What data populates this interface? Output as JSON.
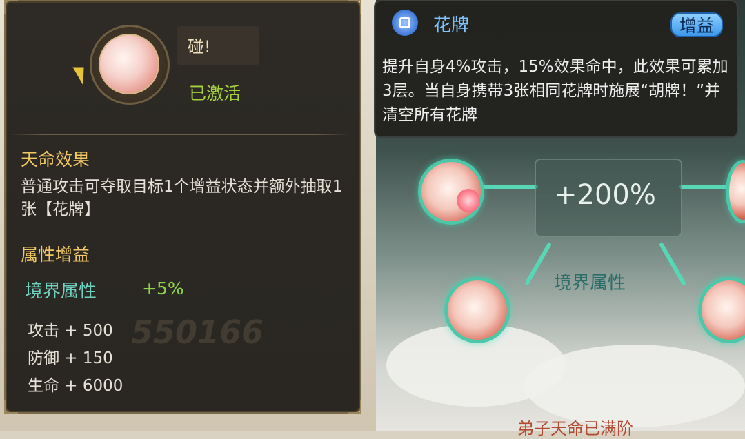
{
  "left_panel": {
    "skill_title": "碰!",
    "status": "已激活",
    "destiny_heading": "天命效果",
    "destiny_desc": "普通攻击可夺取目标1个增益状态并额外抽取1张【花牌】",
    "attr_heading": "属性增益",
    "realm_label": "境界属性",
    "realm_value": "+5%",
    "stats": [
      {
        "label": "攻击 + 500"
      },
      {
        "label": "防御 + 150"
      },
      {
        "label": "生命 + 6000"
      }
    ],
    "watermark": "550166"
  },
  "right_panel": {
    "card_name": "花牌",
    "badge": "增益",
    "description": "提升自身4%攻击，15%效果命中，此效果可累加3层。当自身携带3张相同花牌时施展“胡牌！”并清空所有花牌"
  },
  "scene": {
    "bonus_percent": "+200%",
    "realm_label": "境界属性",
    "bottom_text": "弟子天命已满阶"
  },
  "colors": {
    "accent_gold": "#f2c865",
    "active_green": "#a6d33c",
    "realm_teal": "#6fd1c0",
    "card_blue": "#7ec4ff"
  }
}
